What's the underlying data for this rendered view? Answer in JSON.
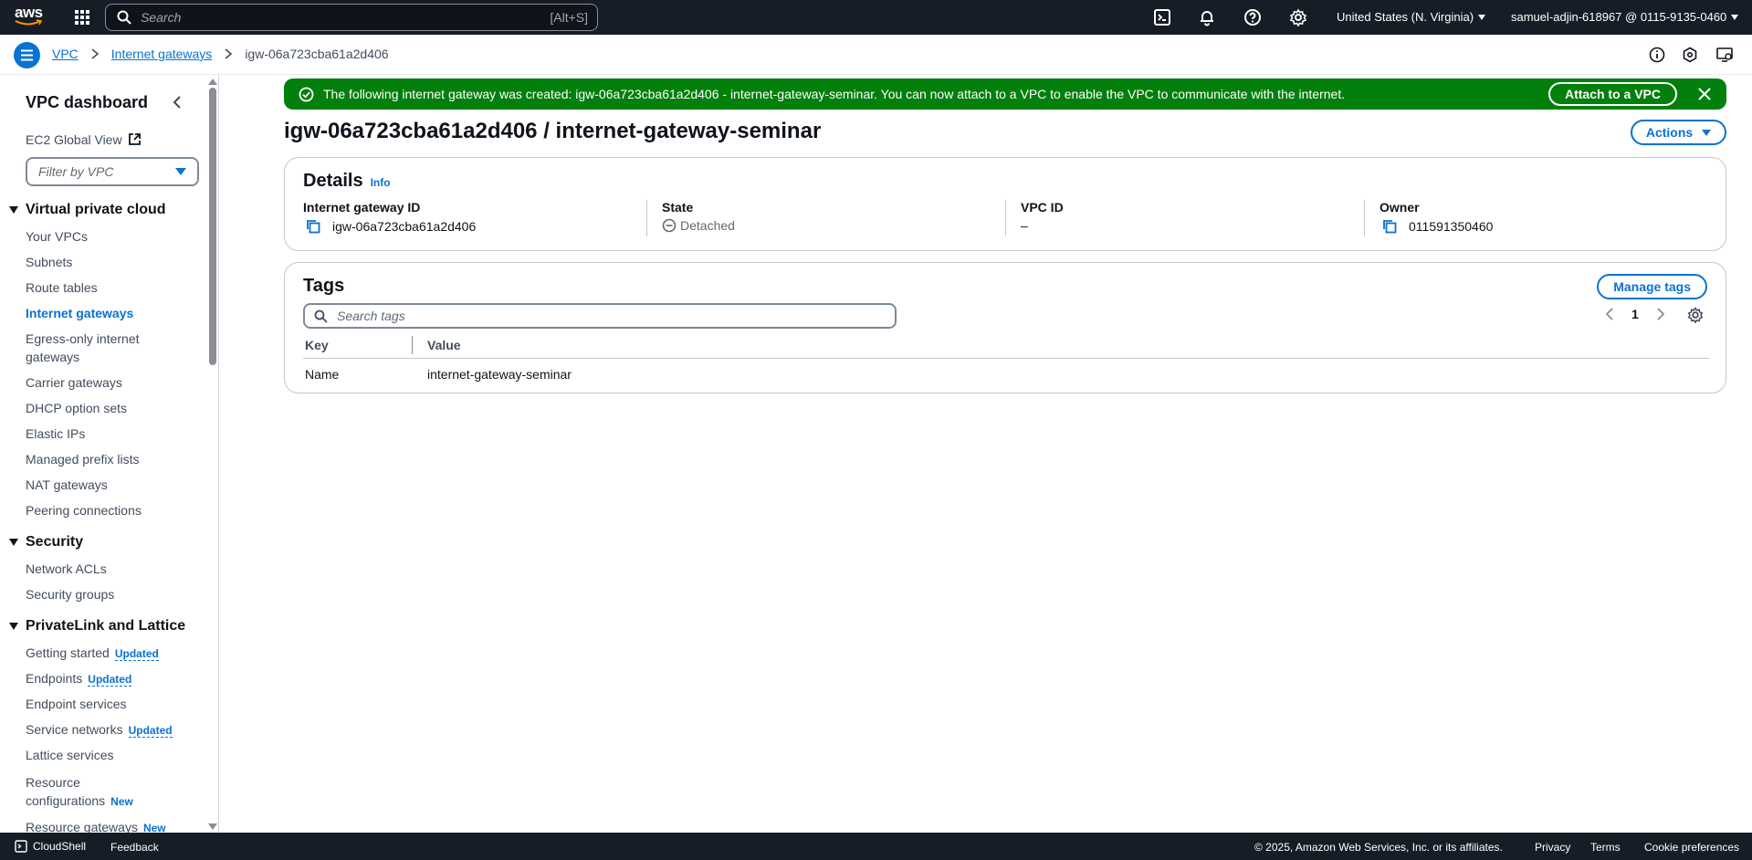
{
  "topnav": {
    "logo_text": "aws",
    "search_placeholder": "Search",
    "search_shortcut": "[Alt+S]",
    "region": "United States (N. Virginia)",
    "account": "samuel-adjin-618967 @ 0115-9135-0460"
  },
  "breadcrumb": {
    "items": [
      "VPC",
      "Internet gateways"
    ],
    "current": "igw-06a723cba61a2d406"
  },
  "sidebar": {
    "title": "VPC dashboard",
    "global_view": "EC2 Global View",
    "filter_placeholder": "Filter by VPC",
    "sections": [
      {
        "title": "Virtual private cloud",
        "items": [
          "Your VPCs",
          "Subnets",
          "Route tables",
          "Internet gateways",
          "Egress-only internet",
          "gateways",
          "Carrier gateways",
          "DHCP option sets",
          "Elastic IPs",
          "Managed prefix lists",
          "NAT gateways",
          "Peering connections"
        ]
      },
      {
        "title": "Security",
        "items": [
          "Network ACLs",
          "Security groups"
        ]
      },
      {
        "title": "PrivateLink and Lattice",
        "items": [
          "Getting started",
          "Endpoints",
          "Endpoint services",
          "Service networks",
          "Lattice services",
          "Resource",
          "configurations",
          "Resource gateways"
        ]
      }
    ],
    "badges": {
      "updated": "Updated",
      "new": "New"
    }
  },
  "flash": {
    "message": "The following internet gateway was created: igw-06a723cba61a2d406 - internet-gateway-seminar. You can now attach to a VPC to enable the VPC to communicate with the internet.",
    "button": "Attach to a VPC"
  },
  "page": {
    "title": "igw-06a723cba61a2d406 / internet-gateway-seminar",
    "actions": "Actions"
  },
  "details": {
    "heading": "Details",
    "info": "Info",
    "fields": [
      {
        "label": "Internet gateway ID",
        "value": "igw-06a723cba61a2d406"
      },
      {
        "label": "State",
        "value": "Detached"
      },
      {
        "label": "VPC ID",
        "value": "–"
      },
      {
        "label": "Owner",
        "value": "011591350460"
      }
    ]
  },
  "tags": {
    "heading": "Tags",
    "manage": "Manage tags",
    "search_placeholder": "Search tags",
    "page": "1",
    "columns": [
      "Key",
      "Value"
    ],
    "rows": [
      {
        "key": "Name",
        "value": "internet-gateway-seminar"
      }
    ]
  },
  "footer": {
    "cloudshell": "CloudShell",
    "feedback": "Feedback",
    "copyright": "© 2025, Amazon Web Services, Inc. or its affiliates.",
    "links": [
      "Privacy",
      "Terms",
      "Cookie preferences"
    ]
  },
  "colors": {
    "nav_bg": "#161d26",
    "accent": "#0972d3",
    "success": "#037f0c"
  }
}
